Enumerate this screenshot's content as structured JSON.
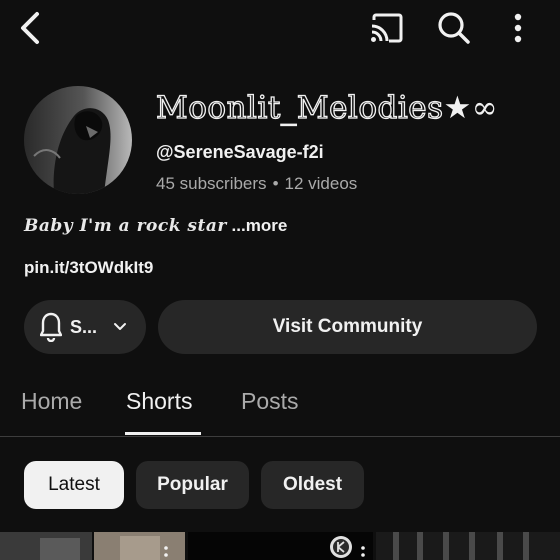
{
  "topbar": {
    "back_icon": "chevron-left-icon",
    "cast_icon": "cast-icon",
    "search_icon": "search-icon",
    "more_icon": "more-vertical-icon"
  },
  "channel": {
    "name": "Moonlit_Melodies",
    "name_symbols": "★∞",
    "handle": "@SereneSavage-f2i",
    "subscribers": "45 subscribers",
    "separator": "•",
    "videos": "12 videos",
    "bio": "Baby I'm a rock star",
    "bio_more": " ...more",
    "link": "pin.it/3tOWdkIt9"
  },
  "actions": {
    "subscribe_label": "S...",
    "subscribe_icon": "bell-icon",
    "visit_community_label": "Visit Community"
  },
  "tabs": [
    {
      "label": "Home",
      "active": false
    },
    {
      "label": "Shorts",
      "active": true
    },
    {
      "label": "Posts",
      "active": false
    }
  ],
  "filters": [
    {
      "label": "Latest",
      "selected": true
    },
    {
      "label": "Popular",
      "selected": false
    },
    {
      "label": "Oldest",
      "selected": false
    }
  ],
  "colors": {
    "background": "#0f0f0f",
    "surface": "#272727",
    "text_primary": "#f1f1f1",
    "text_secondary": "#aaaaaa"
  }
}
